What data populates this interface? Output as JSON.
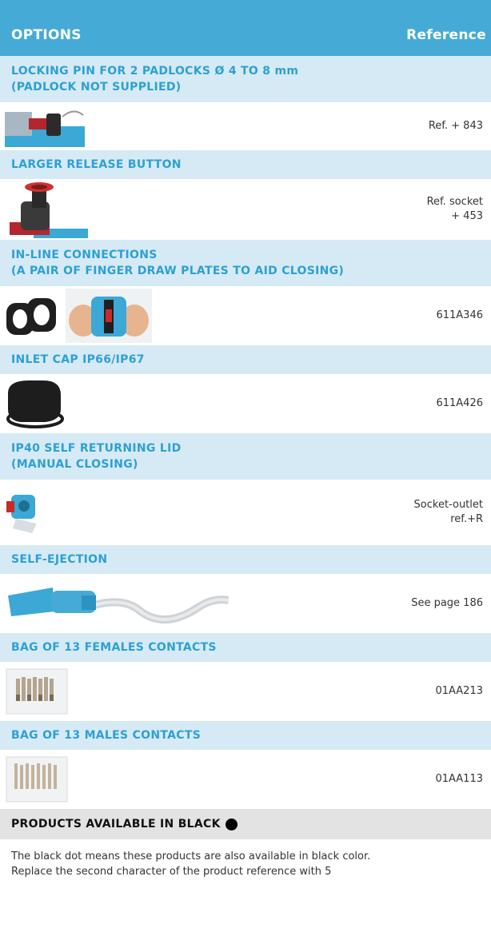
{
  "header": {
    "options_label": "OPTIONS",
    "reference_label": "Reference"
  },
  "options": [
    {
      "title_lines": [
        "LOCKING PIN FOR 2 PADLOCKS Ø 4 TO 8 mm",
        "(PADLOCK NOT SUPPLIED)"
      ],
      "ref_lines": [
        "Ref. + 843"
      ],
      "image": "locking-pin-image"
    },
    {
      "title_lines": [
        "LARGER RELEASE BUTTON"
      ],
      "ref_lines": [
        "Ref. socket",
        "+ 453"
      ],
      "image": "release-button-image"
    },
    {
      "title_lines": [
        "IN-LINE CONNECTIONS",
        "(A PAIR OF FINGER DRAW PLATES TO AID CLOSING)"
      ],
      "ref_lines": [
        "611A346"
      ],
      "image": "finger-draw-plates-image"
    },
    {
      "title_lines": [
        "INLET CAP IP66/IP67"
      ],
      "ref_lines": [
        "611A426"
      ],
      "image": "inlet-cap-image"
    },
    {
      "title_lines": [
        "IP40 SELF RETURNING LID",
        "(MANUAL CLOSING)"
      ],
      "ref_lines": [
        "Socket-outlet",
        "ref.+R"
      ],
      "image": "self-returning-lid-image"
    },
    {
      "title_lines": [
        "SELF-EJECTION"
      ],
      "ref_lines": [
        "See page 186"
      ],
      "image": "self-ejection-image"
    },
    {
      "title_lines": [
        "BAG OF 13 FEMALES CONTACTS"
      ],
      "ref_lines": [
        "01AA213"
      ],
      "image": "female-contacts-bag-image"
    },
    {
      "title_lines": [
        "BAG OF 13 MALES CONTACTS"
      ],
      "ref_lines": [
        "01AA113"
      ],
      "image": "male-contacts-bag-image"
    }
  ],
  "black_section": {
    "title": "PRODUCTS AVAILABLE IN BLACK",
    "note_lines": [
      "The black dot means these products are also available in black color.",
      "Replace the second character of the product reference with 5"
    ]
  },
  "colors": {
    "header_bg": "#45abd6",
    "title_bg": "#d5eaf4",
    "title_text": "#2ea0d2",
    "black_bar_bg": "#e3e3e3"
  }
}
